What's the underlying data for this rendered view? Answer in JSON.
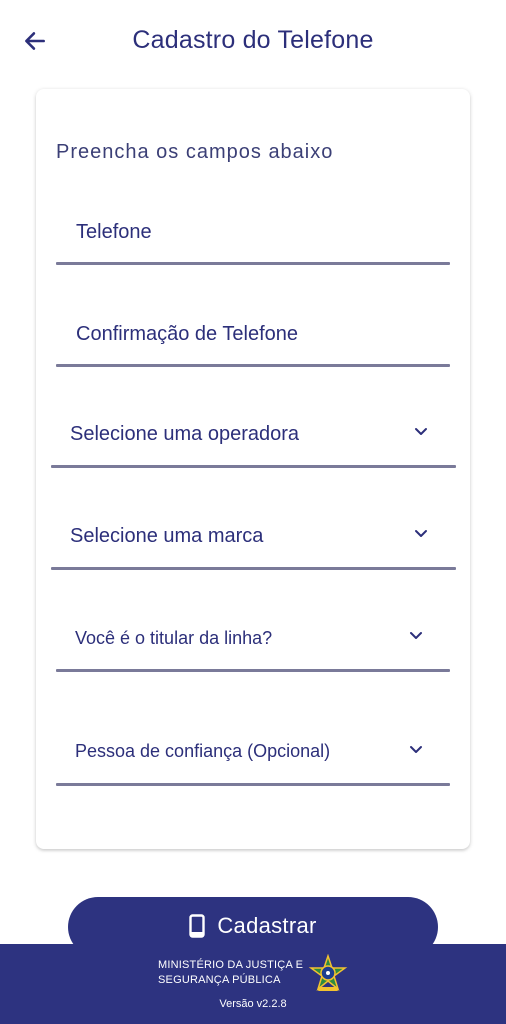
{
  "header": {
    "title": "Cadastro do Telefone",
    "back_icon": "arrow-left-icon"
  },
  "form": {
    "subtitle": "Preencha os campos abaixo",
    "phone_label": "Telefone",
    "phone_confirm_label": "Confirmação de Telefone",
    "operator_select": "Selecione uma operadora",
    "brand_select": "Selecione uma marca",
    "line_holder_select": "Você é o titular da linha?",
    "trusted_person_select": "Pessoa de confiança (Opcional)"
  },
  "submit": {
    "label": "Cadastrar",
    "icon": "smartphone-icon"
  },
  "footer": {
    "ministry_line1": "MINISTÉRIO DA JUSTIÇA E",
    "ministry_line2": "SEGURANÇA PÚBLICA",
    "emblem_icon": "coat-of-arms-icon",
    "version": "Versão v2.2.8"
  },
  "colors": {
    "primary": "#2D3380",
    "text": "#2C2F7A",
    "underline": "#7A7A99",
    "background": "#FFFFFF"
  }
}
